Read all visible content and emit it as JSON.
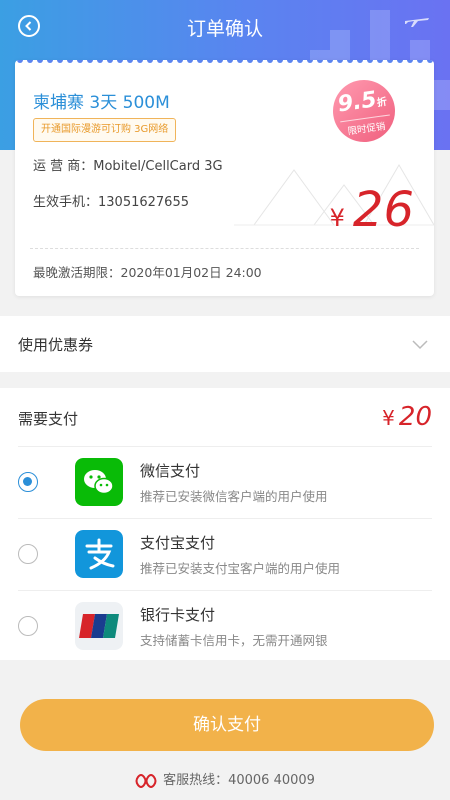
{
  "header": {
    "title": "订单确认"
  },
  "ticket": {
    "package_name": "柬埔寨 3天 500M",
    "tag": "开通国际漫游可订购 3G网络",
    "operator_label": "运 营 商：",
    "operator_value": "Mobitel/CellCard 3G",
    "phone_label": "生效手机：",
    "phone_value": "13051627655",
    "price_symbol": "¥",
    "price_value": "26",
    "deadline_label": "最晚激活期限：",
    "deadline_value": "2020年01月02日  24:00",
    "badge_discount": "9.5",
    "badge_unit": "折",
    "badge_sub": "限时促销"
  },
  "coupon": {
    "label": "使用优惠券"
  },
  "payment": {
    "need_label": "需要支付",
    "price_symbol": "¥",
    "price_value": "20",
    "methods": [
      {
        "title": "微信支付",
        "desc": "推荐已安装微信客户端的用户使用",
        "icon": "wechat-icon",
        "selected": true,
        "color": "#09bb07"
      },
      {
        "title": "支付宝支付",
        "desc": "推荐已安装支付宝客户端的用户使用",
        "icon": "alipay-icon",
        "selected": false,
        "color": "#1296db"
      },
      {
        "title": "银行卡支付",
        "desc": "支持储蓄卡信用卡，无需开通网银",
        "icon": "unionpay-icon",
        "selected": false,
        "color": "#d7242a"
      }
    ]
  },
  "confirm_button": "确认支付",
  "hotline": "客服热线：40006 40009",
  "colors": {
    "header_blue": "#3b9fe3",
    "accent_red": "#d7242a",
    "button_orange": "#f2b24a"
  }
}
